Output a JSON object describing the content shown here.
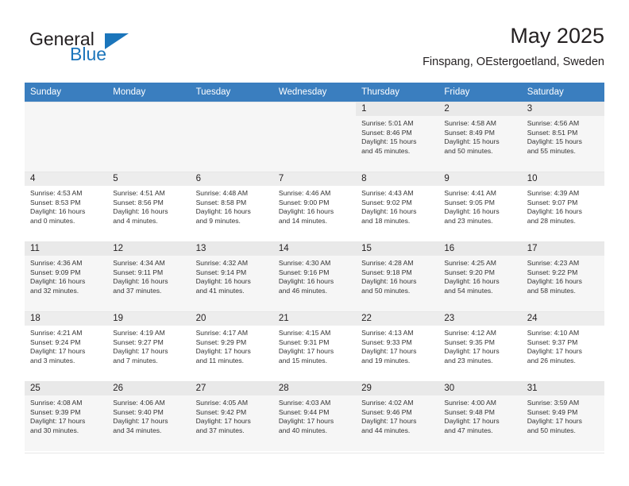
{
  "brand": {
    "name_part1": "General",
    "name_part2": "Blue",
    "triangle_color": "#1b75bb",
    "text_color": "#231f20"
  },
  "header": {
    "title": "May 2025",
    "subtitle": "Finspang, OEstergoetland, Sweden"
  },
  "theme": {
    "header_row_background": "#3a7ebf",
    "header_row_text": "#ffffff",
    "daynum_background": "#ededed",
    "shaded_row_background": "#f6f6f6",
    "grid_line": "#e7e7e7"
  },
  "weekday_headers": [
    "Sunday",
    "Monday",
    "Tuesday",
    "Wednesday",
    "Thursday",
    "Friday",
    "Saturday"
  ],
  "weeks": [
    {
      "shaded": true,
      "days": [
        {
          "empty": true
        },
        {
          "empty": true
        },
        {
          "empty": true
        },
        {
          "empty": true
        },
        {
          "day": "1",
          "sunrise": "Sunrise: 5:01 AM",
          "sunset": "Sunset: 8:46 PM",
          "daylight_line1": "Daylight: 15 hours",
          "daylight_line2": "and 45 minutes."
        },
        {
          "day": "2",
          "sunrise": "Sunrise: 4:58 AM",
          "sunset": "Sunset: 8:49 PM",
          "daylight_line1": "Daylight: 15 hours",
          "daylight_line2": "and 50 minutes."
        },
        {
          "day": "3",
          "sunrise": "Sunrise: 4:56 AM",
          "sunset": "Sunset: 8:51 PM",
          "daylight_line1": "Daylight: 15 hours",
          "daylight_line2": "and 55 minutes."
        }
      ]
    },
    {
      "shaded": false,
      "days": [
        {
          "day": "4",
          "sunrise": "Sunrise: 4:53 AM",
          "sunset": "Sunset: 8:53 PM",
          "daylight_line1": "Daylight: 16 hours",
          "daylight_line2": "and 0 minutes."
        },
        {
          "day": "5",
          "sunrise": "Sunrise: 4:51 AM",
          "sunset": "Sunset: 8:56 PM",
          "daylight_line1": "Daylight: 16 hours",
          "daylight_line2": "and 4 minutes."
        },
        {
          "day": "6",
          "sunrise": "Sunrise: 4:48 AM",
          "sunset": "Sunset: 8:58 PM",
          "daylight_line1": "Daylight: 16 hours",
          "daylight_line2": "and 9 minutes."
        },
        {
          "day": "7",
          "sunrise": "Sunrise: 4:46 AM",
          "sunset": "Sunset: 9:00 PM",
          "daylight_line1": "Daylight: 16 hours",
          "daylight_line2": "and 14 minutes."
        },
        {
          "day": "8",
          "sunrise": "Sunrise: 4:43 AM",
          "sunset": "Sunset: 9:02 PM",
          "daylight_line1": "Daylight: 16 hours",
          "daylight_line2": "and 18 minutes."
        },
        {
          "day": "9",
          "sunrise": "Sunrise: 4:41 AM",
          "sunset": "Sunset: 9:05 PM",
          "daylight_line1": "Daylight: 16 hours",
          "daylight_line2": "and 23 minutes."
        },
        {
          "day": "10",
          "sunrise": "Sunrise: 4:39 AM",
          "sunset": "Sunset: 9:07 PM",
          "daylight_line1": "Daylight: 16 hours",
          "daylight_line2": "and 28 minutes."
        }
      ]
    },
    {
      "shaded": true,
      "days": [
        {
          "day": "11",
          "sunrise": "Sunrise: 4:36 AM",
          "sunset": "Sunset: 9:09 PM",
          "daylight_line1": "Daylight: 16 hours",
          "daylight_line2": "and 32 minutes."
        },
        {
          "day": "12",
          "sunrise": "Sunrise: 4:34 AM",
          "sunset": "Sunset: 9:11 PM",
          "daylight_line1": "Daylight: 16 hours",
          "daylight_line2": "and 37 minutes."
        },
        {
          "day": "13",
          "sunrise": "Sunrise: 4:32 AM",
          "sunset": "Sunset: 9:14 PM",
          "daylight_line1": "Daylight: 16 hours",
          "daylight_line2": "and 41 minutes."
        },
        {
          "day": "14",
          "sunrise": "Sunrise: 4:30 AM",
          "sunset": "Sunset: 9:16 PM",
          "daylight_line1": "Daylight: 16 hours",
          "daylight_line2": "and 46 minutes."
        },
        {
          "day": "15",
          "sunrise": "Sunrise: 4:28 AM",
          "sunset": "Sunset: 9:18 PM",
          "daylight_line1": "Daylight: 16 hours",
          "daylight_line2": "and 50 minutes."
        },
        {
          "day": "16",
          "sunrise": "Sunrise: 4:25 AM",
          "sunset": "Sunset: 9:20 PM",
          "daylight_line1": "Daylight: 16 hours",
          "daylight_line2": "and 54 minutes."
        },
        {
          "day": "17",
          "sunrise": "Sunrise: 4:23 AM",
          "sunset": "Sunset: 9:22 PM",
          "daylight_line1": "Daylight: 16 hours",
          "daylight_line2": "and 58 minutes."
        }
      ]
    },
    {
      "shaded": false,
      "days": [
        {
          "day": "18",
          "sunrise": "Sunrise: 4:21 AM",
          "sunset": "Sunset: 9:24 PM",
          "daylight_line1": "Daylight: 17 hours",
          "daylight_line2": "and 3 minutes."
        },
        {
          "day": "19",
          "sunrise": "Sunrise: 4:19 AM",
          "sunset": "Sunset: 9:27 PM",
          "daylight_line1": "Daylight: 17 hours",
          "daylight_line2": "and 7 minutes."
        },
        {
          "day": "20",
          "sunrise": "Sunrise: 4:17 AM",
          "sunset": "Sunset: 9:29 PM",
          "daylight_line1": "Daylight: 17 hours",
          "daylight_line2": "and 11 minutes."
        },
        {
          "day": "21",
          "sunrise": "Sunrise: 4:15 AM",
          "sunset": "Sunset: 9:31 PM",
          "daylight_line1": "Daylight: 17 hours",
          "daylight_line2": "and 15 minutes."
        },
        {
          "day": "22",
          "sunrise": "Sunrise: 4:13 AM",
          "sunset": "Sunset: 9:33 PM",
          "daylight_line1": "Daylight: 17 hours",
          "daylight_line2": "and 19 minutes."
        },
        {
          "day": "23",
          "sunrise": "Sunrise: 4:12 AM",
          "sunset": "Sunset: 9:35 PM",
          "daylight_line1": "Daylight: 17 hours",
          "daylight_line2": "and 23 minutes."
        },
        {
          "day": "24",
          "sunrise": "Sunrise: 4:10 AM",
          "sunset": "Sunset: 9:37 PM",
          "daylight_line1": "Daylight: 17 hours",
          "daylight_line2": "and 26 minutes."
        }
      ]
    },
    {
      "shaded": true,
      "days": [
        {
          "day": "25",
          "sunrise": "Sunrise: 4:08 AM",
          "sunset": "Sunset: 9:39 PM",
          "daylight_line1": "Daylight: 17 hours",
          "daylight_line2": "and 30 minutes."
        },
        {
          "day": "26",
          "sunrise": "Sunrise: 4:06 AM",
          "sunset": "Sunset: 9:40 PM",
          "daylight_line1": "Daylight: 17 hours",
          "daylight_line2": "and 34 minutes."
        },
        {
          "day": "27",
          "sunrise": "Sunrise: 4:05 AM",
          "sunset": "Sunset: 9:42 PM",
          "daylight_line1": "Daylight: 17 hours",
          "daylight_line2": "and 37 minutes."
        },
        {
          "day": "28",
          "sunrise": "Sunrise: 4:03 AM",
          "sunset": "Sunset: 9:44 PM",
          "daylight_line1": "Daylight: 17 hours",
          "daylight_line2": "and 40 minutes."
        },
        {
          "day": "29",
          "sunrise": "Sunrise: 4:02 AM",
          "sunset": "Sunset: 9:46 PM",
          "daylight_line1": "Daylight: 17 hours",
          "daylight_line2": "and 44 minutes."
        },
        {
          "day": "30",
          "sunrise": "Sunrise: 4:00 AM",
          "sunset": "Sunset: 9:48 PM",
          "daylight_line1": "Daylight: 17 hours",
          "daylight_line2": "and 47 minutes."
        },
        {
          "day": "31",
          "sunrise": "Sunrise: 3:59 AM",
          "sunset": "Sunset: 9:49 PM",
          "daylight_line1": "Daylight: 17 hours",
          "daylight_line2": "and 50 minutes."
        }
      ]
    }
  ]
}
